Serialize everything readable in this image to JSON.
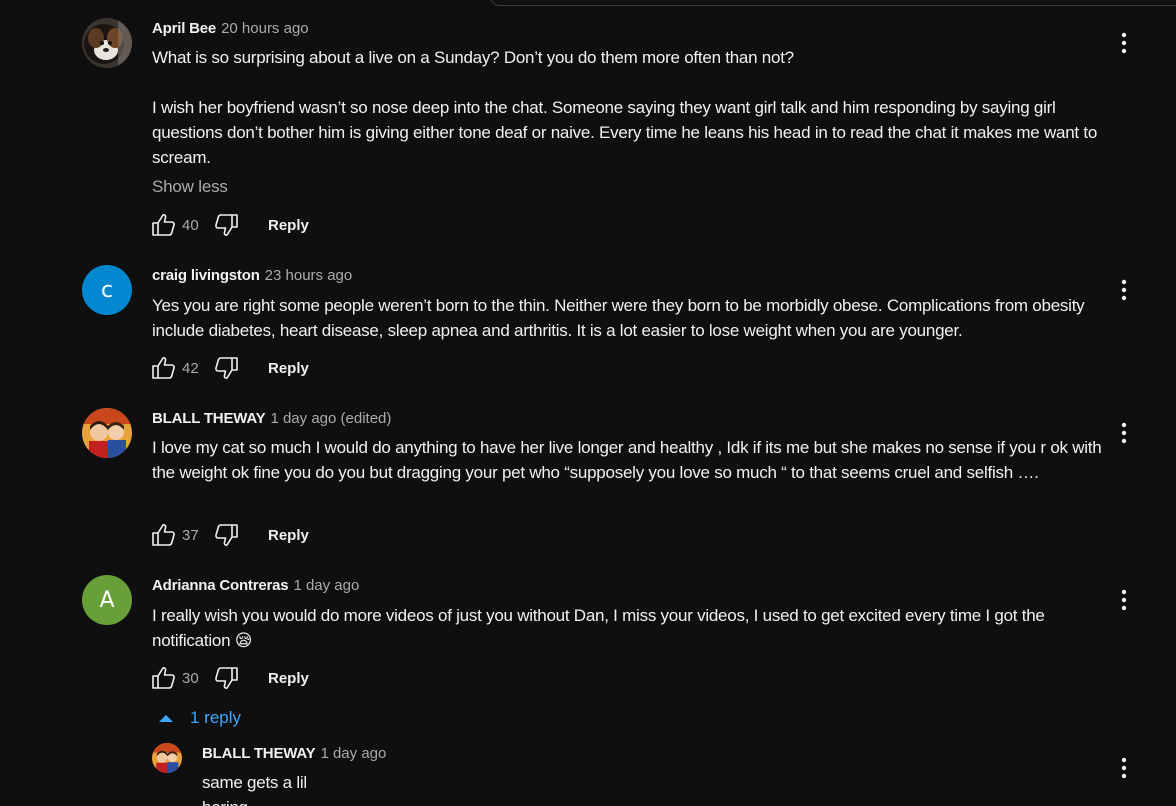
{
  "colors": {
    "background": "#0f0f0f",
    "text": "#f1f1f1",
    "muted": "#aaaaaa",
    "link": "#3ea6ff",
    "avatar_c": "#0288d1",
    "avatar_a": "#689f38"
  },
  "comments": [
    {
      "author": "April Bee",
      "time": "20 hours ago",
      "text": "What is so surprising about a live on a Sunday? Don’t you do them more often than not?\n\nI wish her boyfriend wasn’t so nose deep into the chat. Someone saying they want girl talk and him responding by saying girl questions don’t bother him is giving either tone deaf or naive. Every time he leans his head in to read the chat it makes me want to scream.",
      "show_less": "Show less",
      "likes": "40",
      "reply_label": "Reply",
      "avatar_icon": "dog-photo-avatar"
    },
    {
      "author": "craig livingston",
      "time": "23 hours ago",
      "text": "Yes you are right some people weren’t born to the thin. Neither were they born to be morbidly obese.  Complications from obesity include diabetes, heart disease, sleep apnea and arthritis.  It is a lot easier to lose weight when you are younger.",
      "likes": "42",
      "reply_label": "Reply",
      "avatar_letter": "c"
    },
    {
      "author": "BLALL THEWAY",
      "time": "1 day ago (edited)",
      "text": "I love my cat so much I would do anything to have her live longer and healthy , Idk if its me but she makes no sense if you r ok with the weight ok fine you do you but dragging your pet who “supposely you love so much “ to that seems cruel and selfish ….",
      "likes": "37",
      "reply_label": "Reply",
      "avatar_icon": "two-people-cartoon-avatar"
    },
    {
      "author": "Adrianna Contreras",
      "time": "1 day ago",
      "text": "I really wish you would do more videos of just you without Dan, I miss your videos, I used to get excited every time I got the notification 😪",
      "likes": "30",
      "reply_label": "Reply",
      "avatar_letter": "A"
    }
  ],
  "replies_toggle": {
    "label": "1 reply"
  },
  "reply": {
    "author": "BLALL THEWAY",
    "time": "1 day ago",
    "text": "same gets a lil\nboring"
  }
}
